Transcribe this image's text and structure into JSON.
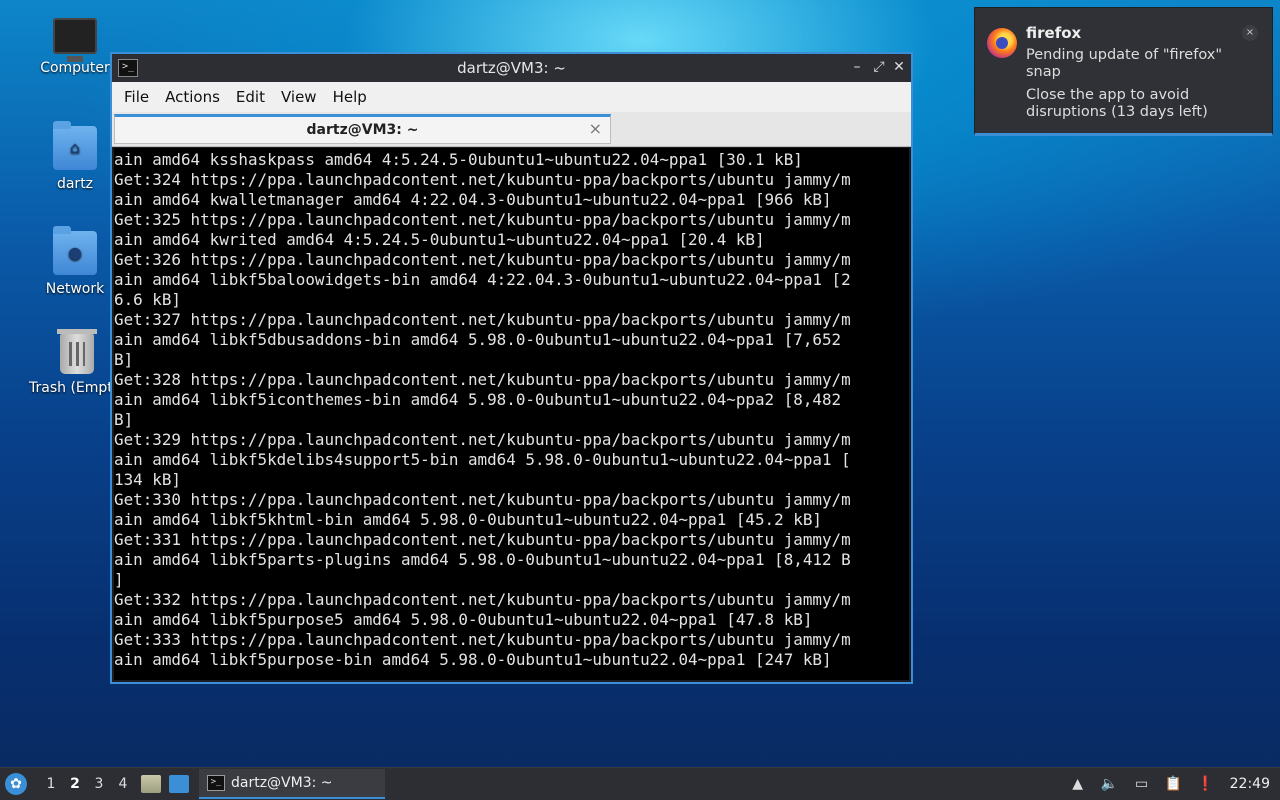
{
  "desktop": {
    "icons": [
      {
        "label": "Computer"
      },
      {
        "label": "dartz"
      },
      {
        "label": "Network"
      },
      {
        "label": "Trash (Empty)"
      }
    ]
  },
  "window": {
    "title": "dartz@VM3: ~",
    "menu": [
      "File",
      "Actions",
      "Edit",
      "View",
      "Help"
    ],
    "tab_title": "dartz@VM3: ~",
    "terminal_lines": [
      "ain amd64 ksshaskpass amd64 4:5.24.5-0ubuntu1~ubuntu22.04~ppa1 [30.1 kB]",
      "Get:324 https://ppa.launchpadcontent.net/kubuntu-ppa/backports/ubuntu jammy/m",
      "ain amd64 kwalletmanager amd64 4:22.04.3-0ubuntu1~ubuntu22.04~ppa1 [966 kB]",
      "Get:325 https://ppa.launchpadcontent.net/kubuntu-ppa/backports/ubuntu jammy/m",
      "ain amd64 kwrited amd64 4:5.24.5-0ubuntu1~ubuntu22.04~ppa1 [20.4 kB]",
      "Get:326 https://ppa.launchpadcontent.net/kubuntu-ppa/backports/ubuntu jammy/m",
      "ain amd64 libkf5baloowidgets-bin amd64 4:22.04.3-0ubuntu1~ubuntu22.04~ppa1 [2",
      "6.6 kB]",
      "Get:327 https://ppa.launchpadcontent.net/kubuntu-ppa/backports/ubuntu jammy/m",
      "ain amd64 libkf5dbusaddons-bin amd64 5.98.0-0ubuntu1~ubuntu22.04~ppa1 [7,652",
      "B]",
      "Get:328 https://ppa.launchpadcontent.net/kubuntu-ppa/backports/ubuntu jammy/m",
      "ain amd64 libkf5iconthemes-bin amd64 5.98.0-0ubuntu1~ubuntu22.04~ppa2 [8,482",
      "B]",
      "Get:329 https://ppa.launchpadcontent.net/kubuntu-ppa/backports/ubuntu jammy/m",
      "ain amd64 libkf5kdelibs4support5-bin amd64 5.98.0-0ubuntu1~ubuntu22.04~ppa1 [",
      "134 kB]",
      "Get:330 https://ppa.launchpadcontent.net/kubuntu-ppa/backports/ubuntu jammy/m",
      "ain amd64 libkf5khtml-bin amd64 5.98.0-0ubuntu1~ubuntu22.04~ppa1 [45.2 kB]",
      "Get:331 https://ppa.launchpadcontent.net/kubuntu-ppa/backports/ubuntu jammy/m",
      "ain amd64 libkf5parts-plugins amd64 5.98.0-0ubuntu1~ubuntu22.04~ppa1 [8,412 B",
      "]",
      "Get:332 https://ppa.launchpadcontent.net/kubuntu-ppa/backports/ubuntu jammy/m",
      "ain amd64 libkf5purpose5 amd64 5.98.0-0ubuntu1~ubuntu22.04~ppa1 [47.8 kB]",
      "Get:333 https://ppa.launchpadcontent.net/kubuntu-ppa/backports/ubuntu jammy/m",
      "ain amd64 libkf5purpose-bin amd64 5.98.0-0ubuntu1~ubuntu22.04~ppa1 [247 kB]"
    ]
  },
  "notification": {
    "app": "firefox",
    "body": "Pending update of \"firefox\" snap",
    "detail": "Close the app to avoid disruptions (13 days left)",
    "close_glyph": "×"
  },
  "taskbar": {
    "workspaces": [
      "1",
      "2",
      "3",
      "4"
    ],
    "active_workspace": "2",
    "task_label": "dartz@VM3: ~",
    "clock": "22:49"
  },
  "colors": {
    "accent": "#3a8fd6",
    "terminal_bg": "#000000",
    "terminal_fg": "#e3e3e3"
  }
}
